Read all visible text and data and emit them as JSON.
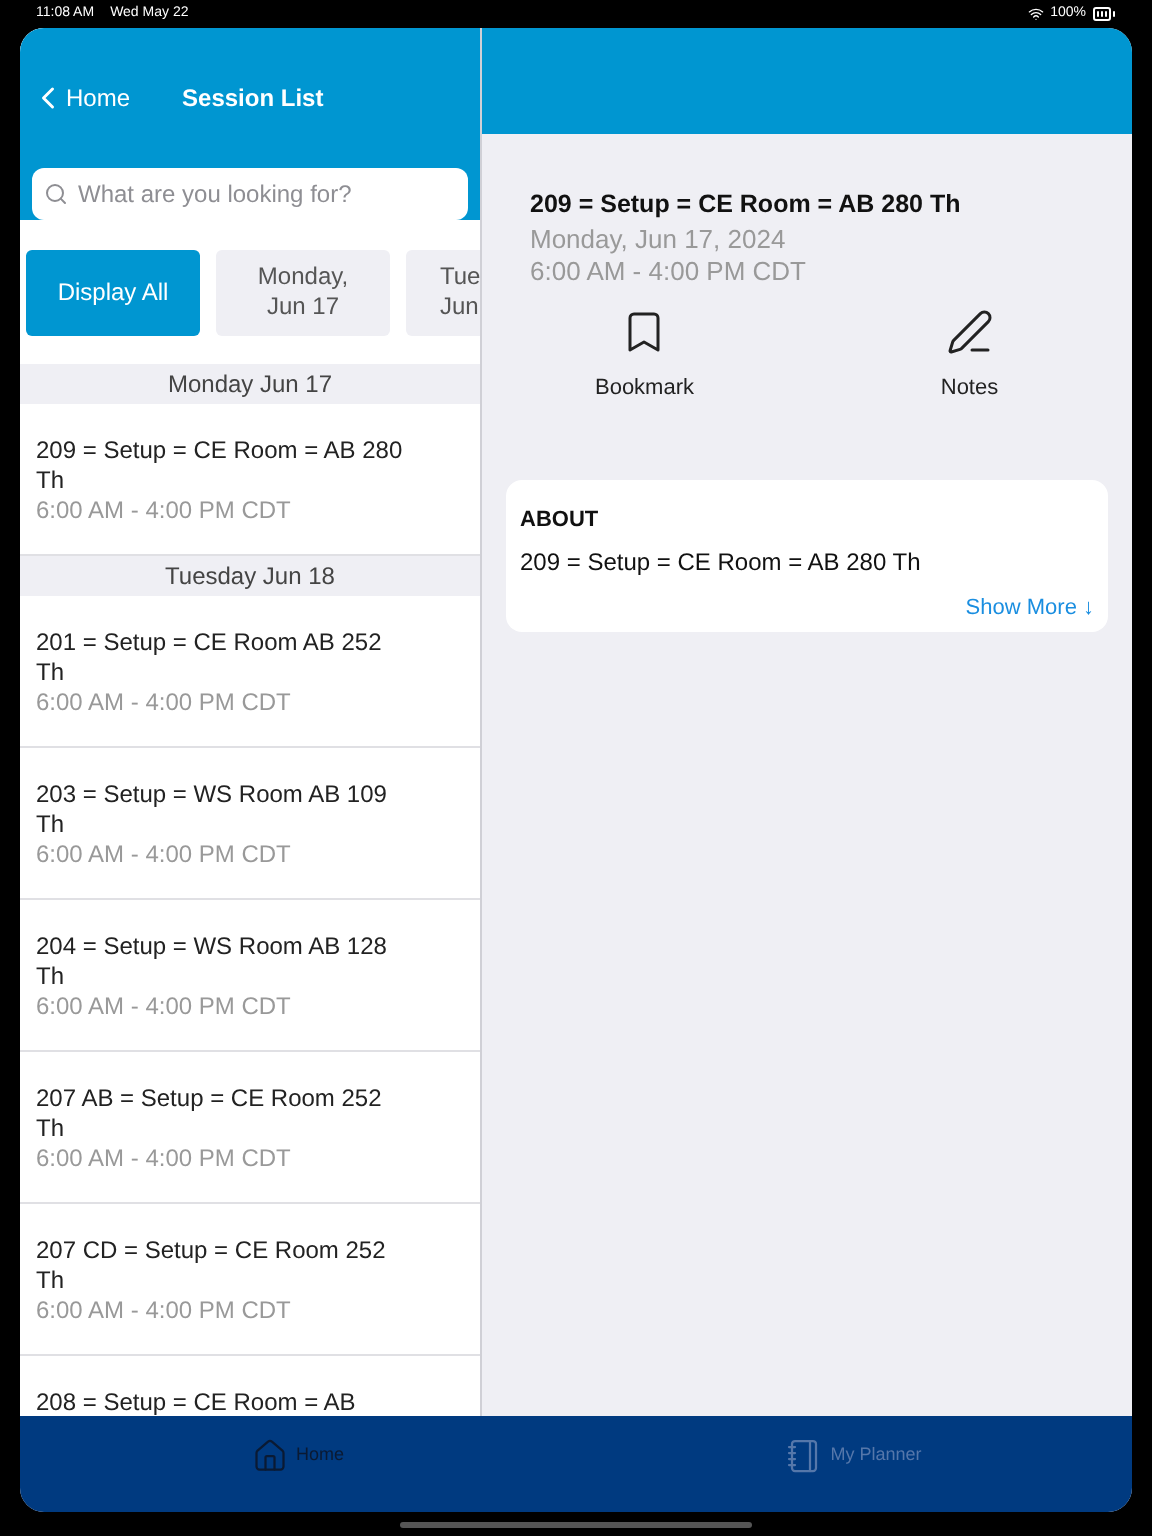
{
  "status_bar": {
    "time": "11:08 AM",
    "date": "Wed May 22",
    "battery": "100%"
  },
  "nav": {
    "back": "Home",
    "title": "Session List"
  },
  "search": {
    "placeholder": "What are you looking for?"
  },
  "day_filters": [
    {
      "lines": [
        "Display All"
      ],
      "selected": true
    },
    {
      "lines": [
        "Monday,",
        "Jun 17"
      ],
      "selected": false
    },
    {
      "lines": [
        "Tue",
        "Jun"
      ],
      "selected": false
    }
  ],
  "sections": [
    {
      "header": "Monday Jun 17",
      "sessions": [
        {
          "title": "209 = Setup = CE Room = AB 280 Th",
          "time": "6:00 AM - 4:00 PM CDT"
        }
      ]
    },
    {
      "header": "Tuesday Jun 18",
      "sessions": [
        {
          "title": "201 = Setup = CE Room AB 252 Th",
          "time": "6:00 AM - 4:00 PM CDT"
        },
        {
          "title": "203 = Setup = WS Room AB 109 Th",
          "time": "6:00 AM - 4:00 PM CDT"
        },
        {
          "title": "204 = Setup = WS Room AB 128 Th",
          "time": "6:00 AM - 4:00 PM CDT"
        },
        {
          "title": "207 AB = Setup = CE Room 252 Th",
          "time": "6:00 AM - 4:00 PM CDT"
        },
        {
          "title": "207 CD = Setup = CE Room 252 Th",
          "time": "6:00 AM - 4:00 PM CDT"
        },
        {
          "title": "208 = Setup = CE Room = AB"
        }
      ]
    }
  ],
  "detail": {
    "title": "209 = Setup = CE Room = AB 280 Th",
    "date": "Monday, Jun 17, 2024",
    "time": "6:00 AM - 4:00 PM CDT",
    "actions": [
      {
        "kind": "bookmark",
        "label": "Bookmark"
      },
      {
        "kind": "notes",
        "label": "Notes"
      }
    ],
    "about": {
      "heading": "ABOUT",
      "text": "209 = Setup = CE Room = AB 280 Th",
      "link": "Show More",
      "link_icon": "↓"
    }
  },
  "tab_bar": [
    {
      "kind": "home",
      "label": "Home",
      "selected": true
    },
    {
      "kind": "planner",
      "label": "My Planner",
      "selected": false
    }
  ]
}
